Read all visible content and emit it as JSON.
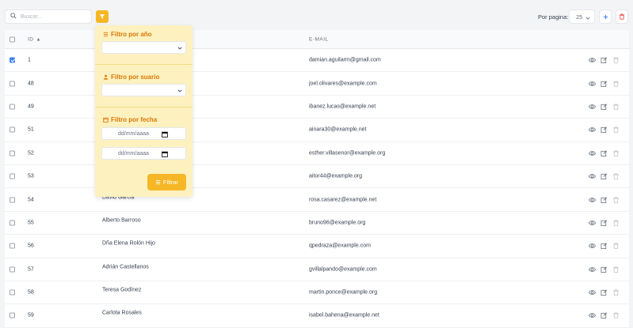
{
  "toolbar": {
    "search_placeholder": "Buscar...",
    "per_page_label": "Por pagina:",
    "per_page_value": "25"
  },
  "table": {
    "headers": {
      "id": "ID",
      "email": "E-MAIL"
    },
    "rows": [
      {
        "id": "1",
        "name": "",
        "email": "damian.aguilarm@gmail.com",
        "checked": true
      },
      {
        "id": "48",
        "name": "",
        "email": "joel.olivares@example.com",
        "checked": false
      },
      {
        "id": "49",
        "name": "",
        "email": "ibanez.lucas@example.net",
        "checked": false
      },
      {
        "id": "51",
        "name": "",
        "email": "ainara30@example.net",
        "checked": false
      },
      {
        "id": "52",
        "name": "",
        "email": "esther.villasenor@example.org",
        "checked": false
      },
      {
        "id": "53",
        "name": "",
        "email": "aitor44@example.org",
        "checked": false
      },
      {
        "id": "54",
        "name": "David Garcia",
        "email": "rosa.casarez@example.net",
        "checked": false
      },
      {
        "id": "55",
        "name": "Alberto Barroso",
        "email": "bruno96@example.org",
        "checked": false
      },
      {
        "id": "56",
        "name": "Dña Elena Rolón Hijo",
        "email": "qpedraza@example.com",
        "checked": false
      },
      {
        "id": "57",
        "name": "Adrián Castellanos",
        "email": "gvillalpando@example.com",
        "checked": false
      },
      {
        "id": "58",
        "name": "Teresa Godínez",
        "email": "martin.ponce@example.org",
        "checked": false
      },
      {
        "id": "59",
        "name": "Carlota Rosales",
        "email": "isabel.bahena@example.net",
        "checked": false
      }
    ]
  },
  "filter_panel": {
    "year_title": "Filtro por año",
    "user_title": "Filtro por suario",
    "date_title": "Filtro por fecha",
    "date_from_placeholder": "dd/mm/aaaa",
    "date_to_placeholder": "dd/mm/aaaa",
    "apply_label": "Filtrar"
  },
  "colors": {
    "accent": "#f6b726",
    "accent_text": "#d97706",
    "panel_bg": "#fdf1c0",
    "primary": "#3b82f6",
    "danger": "#ef4444"
  },
  "icons": [
    "search-icon",
    "filter-icon",
    "plus-icon",
    "trash-icon",
    "eye-icon",
    "edit-icon",
    "calendar-icon",
    "user-icon",
    "list-icon"
  ]
}
